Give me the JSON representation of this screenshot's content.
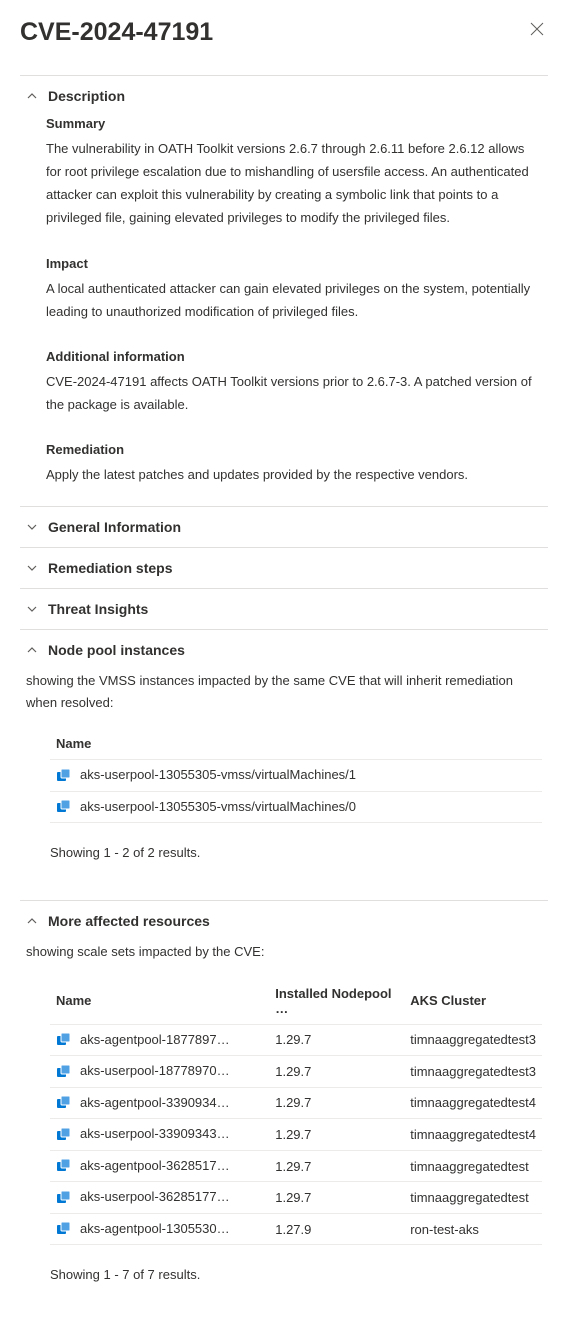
{
  "header": {
    "title": "CVE-2024-47191",
    "close_aria": "Close"
  },
  "sections": {
    "description": {
      "title": "Description",
      "summary_label": "Summary",
      "summary_text": "The vulnerability in OATH Toolkit versions 2.6.7 through 2.6.11 before 2.6.12 allows for root privilege escalation due to mishandling of usersfile access. An authenticated attacker can exploit this vulnerability by creating a symbolic link that points to a privileged file, gaining elevated privileges to modify the privileged files.",
      "impact_label": "Impact",
      "impact_text": "A local authenticated attacker can gain elevated privileges on the system, potentially leading to unauthorized modification of privileged files.",
      "addl_label": "Additional information",
      "addl_text": "CVE-2024-47191 affects OATH Toolkit versions prior to 2.6.7-3. A patched version of the package is available.",
      "remed_label": "Remediation",
      "remed_text": "Apply the latest patches and updates provided by the respective vendors."
    },
    "general_info": {
      "title": "General Information"
    },
    "remediation_steps": {
      "title": "Remediation steps"
    },
    "threat_insights": {
      "title": "Threat Insights"
    },
    "node_pool": {
      "title": "Node pool instances",
      "intro": "showing the VMSS instances impacted by the same CVE that will inherit remediation when resolved:",
      "col_name": "Name",
      "rows": [
        {
          "name": "aks-userpool-13055305-vmss/virtualMachines/1"
        },
        {
          "name": "aks-userpool-13055305-vmss/virtualMachines/0"
        }
      ],
      "showing": "Showing 1 - 2 of 2 results."
    },
    "more_affected": {
      "title": "More affected resources",
      "intro": "showing scale sets impacted by the CVE:",
      "col_name": "Name",
      "col_version": "Installed Nodepool …",
      "col_cluster": "AKS Cluster",
      "rows": [
        {
          "name": "aks-agentpool-1877897…",
          "version": "1.29.7",
          "cluster": "timnaaggregatedtest3"
        },
        {
          "name": "aks-userpool-18778970…",
          "version": "1.29.7",
          "cluster": "timnaaggregatedtest3"
        },
        {
          "name": "aks-agentpool-3390934…",
          "version": "1.29.7",
          "cluster": "timnaaggregatedtest4"
        },
        {
          "name": "aks-userpool-33909343…",
          "version": "1.29.7",
          "cluster": "timnaaggregatedtest4"
        },
        {
          "name": "aks-agentpool-3628517…",
          "version": "1.29.7",
          "cluster": "timnaaggregatedtest"
        },
        {
          "name": "aks-userpool-36285177…",
          "version": "1.29.7",
          "cluster": "timnaaggregatedtest"
        },
        {
          "name": "aks-agentpool-1305530…",
          "version": "1.27.9",
          "cluster": "ron-test-aks"
        }
      ],
      "showing": "Showing 1 - 7 of 7 results."
    }
  }
}
